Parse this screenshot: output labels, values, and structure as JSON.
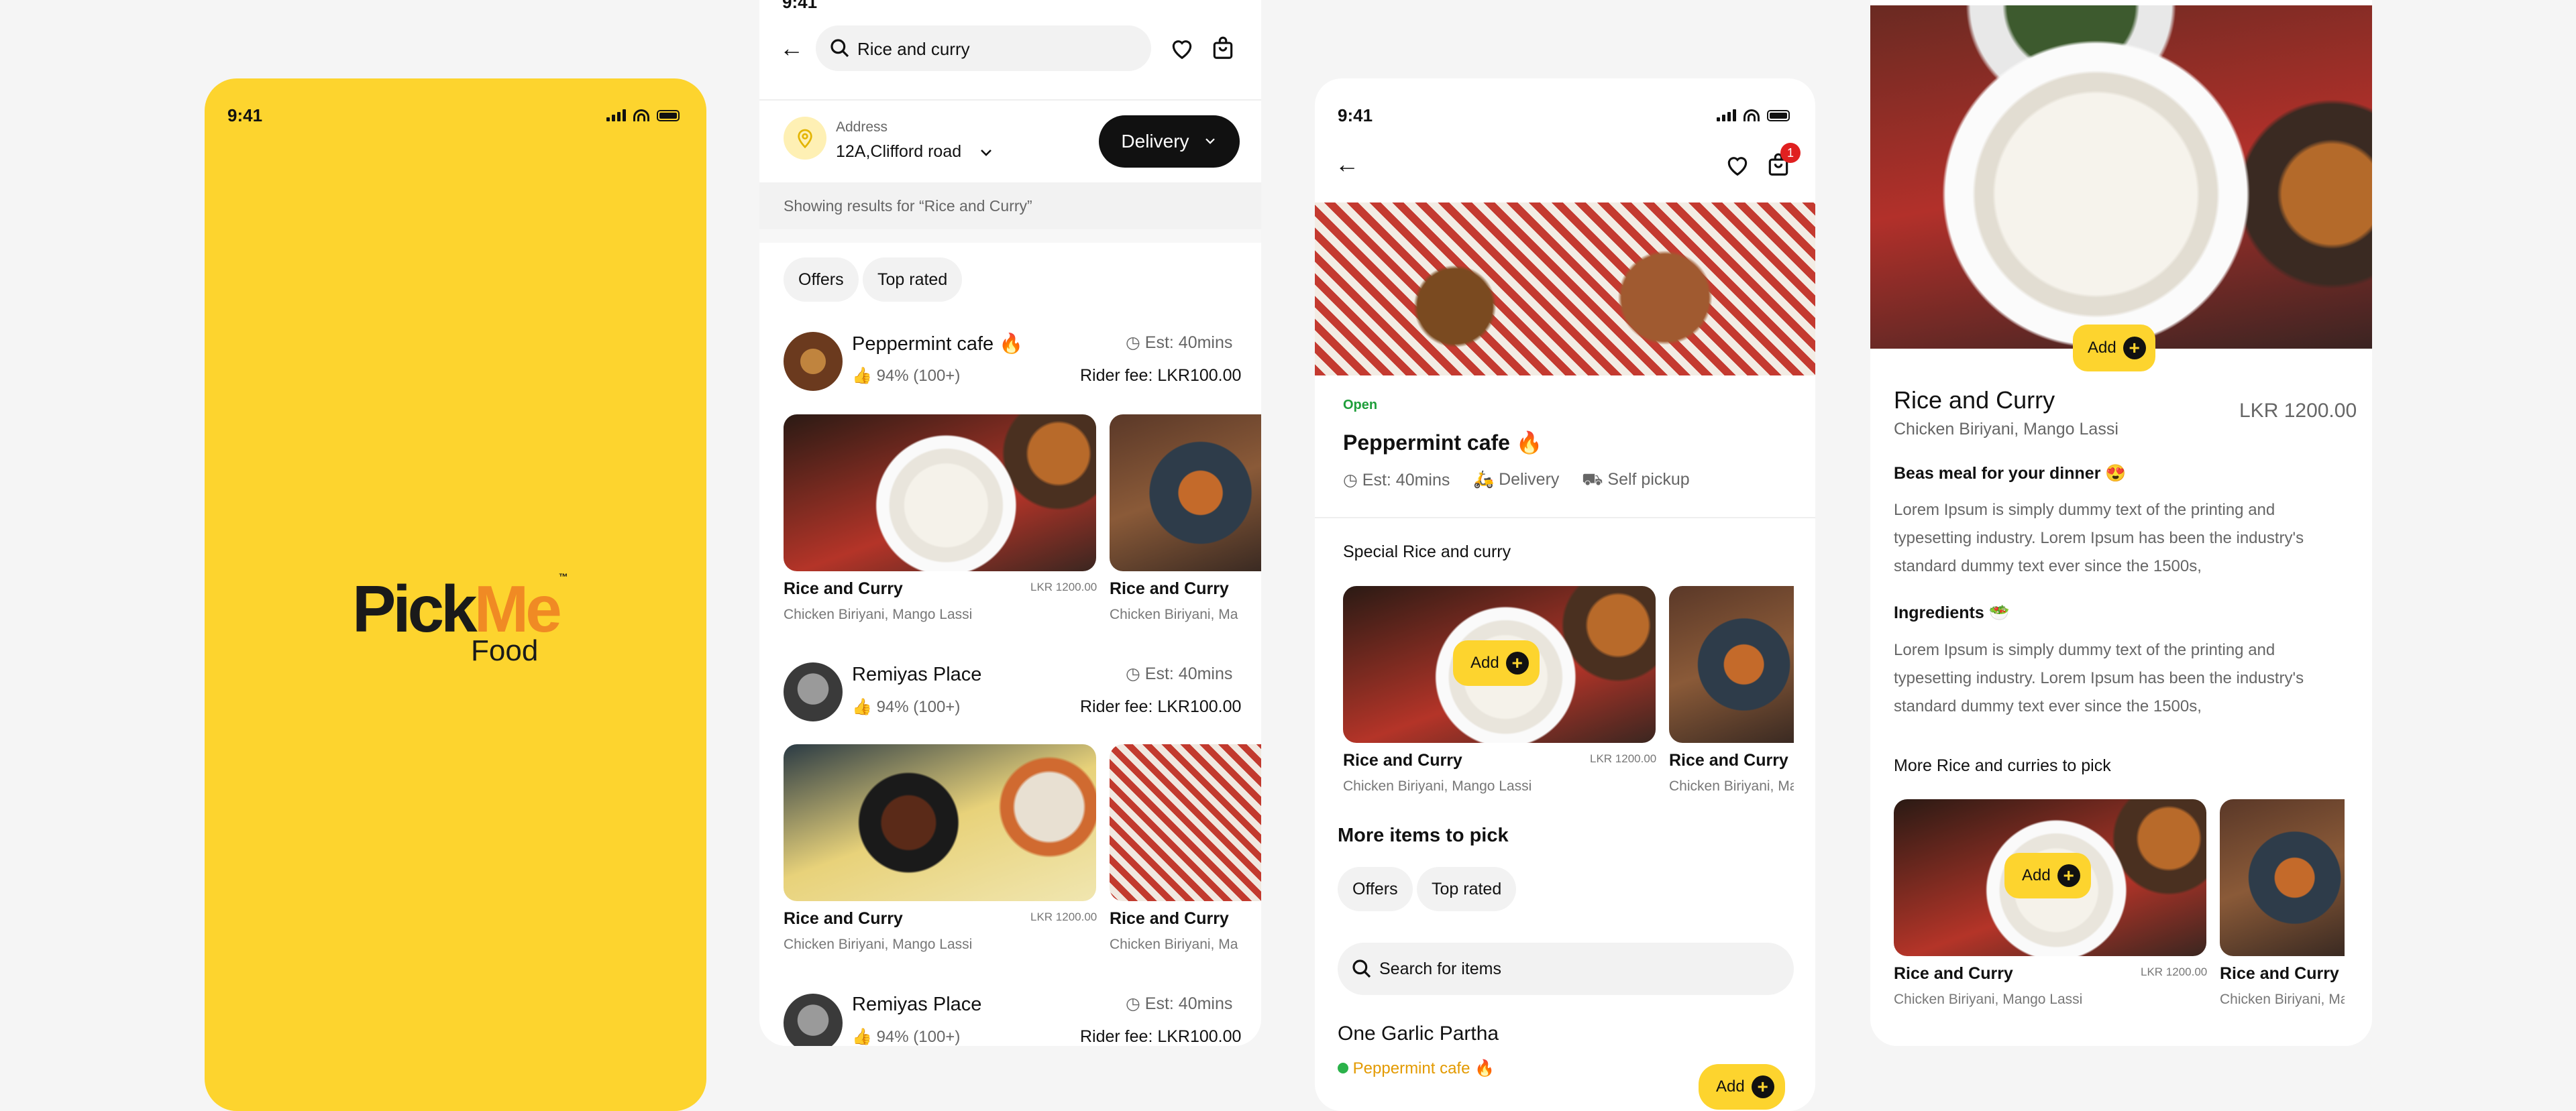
{
  "splash": {
    "time": "9:41",
    "brand_pick": "Pick",
    "brand_me": "Me",
    "brand_tm": "™",
    "brand_sub": "Food",
    "bg": "#FDD42E"
  },
  "search_screen": {
    "time": "9:41",
    "query": "Rice and curry",
    "address_label": "Address",
    "address": "12A,Clifford road",
    "delivery_label": "Delivery",
    "results_text": "Showing results for “Rice and Curry”",
    "filters": [
      "Offers",
      "Top rated"
    ],
    "restaurants": [
      {
        "name": "Peppermint cafe",
        "emoji": "🔥",
        "rating": "94% (100+)",
        "est": "Est: 40mins",
        "fee": "Rider fee: LKR100.00",
        "items": [
          {
            "name": "Rice and Curry",
            "price": "LKR 1200.00",
            "desc": "Chicken Biriyani, Mango Lassi"
          },
          {
            "name": "Rice and Curry",
            "desc": "Chicken Biriyani, Ma"
          }
        ]
      },
      {
        "name": "Remiyas Place",
        "rating": "94% (100+)",
        "est": "Est: 40mins",
        "fee": "Rider fee: LKR100.00",
        "items": [
          {
            "name": "Rice and Curry",
            "price": "LKR 1200.00",
            "desc": "Chicken Biriyani, Mango Lassi"
          },
          {
            "name": "Rice and Curry",
            "desc": "Chicken Biriyani, Ma"
          }
        ]
      },
      {
        "name": "Remiyas Place",
        "rating": "94% (100+)",
        "est": "Est: 40mins",
        "fee": "Rider fee: LKR100.00"
      }
    ]
  },
  "restaurant_screen": {
    "time": "9:41",
    "cart_count": "1",
    "status": "Open",
    "name": "Peppermint cafe",
    "emoji": "🔥",
    "est": "Est: 40mins",
    "delivery": "Delivery",
    "pickup": "Self pickup",
    "special_title": "Special Rice and curry",
    "special_items": [
      {
        "name": "Rice and Curry",
        "price": "LKR 1200.00",
        "desc": "Chicken Biriyani, Mango Lassi",
        "add": "Add"
      },
      {
        "name": "Rice and Curry",
        "desc": "Chicken Biriyani, Ma"
      }
    ],
    "more_title": "More items to pick",
    "filters": [
      "Offers",
      "Top rated"
    ],
    "search_placeholder": "Search for items",
    "item_name": "One Garlic Partha",
    "item_restaurant": "Peppermint cafe",
    "item_add": "Add"
  },
  "item_screen": {
    "add": "Add",
    "name": "Rice and Curry",
    "price": "LKR 1200.00",
    "desc": "Chicken Biriyani, Mango Lassi",
    "meal_title": "Beas meal for your dinner 😍",
    "meal_text": "Lorem Ipsum is simply dummy text of the printing and typesetting industry. Lorem Ipsum has been the industry's standard dummy text ever since the 1500s,",
    "ingredients_title": "Ingredients 🥗",
    "ingredients_text": "Lorem Ipsum is simply dummy text of the printing and typesetting industry. Lorem Ipsum has been the industry's standard dummy text ever since the 1500s,",
    "more_title": "More Rice and curries to pick",
    "more_items": [
      {
        "name": "Rice and Curry",
        "price": "LKR 1200.00",
        "desc": "Chicken Biriyani, Mango Lassi",
        "add": "Add"
      },
      {
        "name": "Rice and Curry",
        "desc": "Chicken Biriyani, Ma"
      }
    ]
  }
}
